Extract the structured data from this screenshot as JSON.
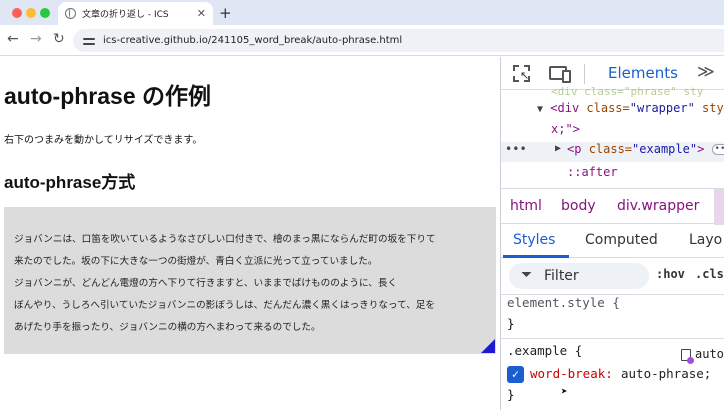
{
  "browser": {
    "tab_title": "文章の折り返し - ICS",
    "url": "ics-creative.github.io/241105_word_break/auto-phrase.html"
  },
  "page": {
    "title": "auto-phrase の作例",
    "lead": "右下のつまみを動かしてリサイズできます。",
    "section_heading": "auto-phrase方式",
    "example_lines": [
      "ジョバンニは、口笛を吹いているようなさびしい口付きで、檜のまっ黒にならんだ町の坂を下りて",
      "来たのでした。坂の下に大きな一つの街燈が、青白く立派に光って立っていました。",
      "ジョバンニが、どんどん電燈の方へ下りて行きますと、いままでばけもののように、長く",
      "ぼんやり、うしろへ引いていたジョバンニの影ぼうしは、だんだん濃く黒くはっきりなって、足を",
      "あげたり手を振ったり、ジョバンニの横の方へまわって来るのでした。"
    ]
  },
  "devtools": {
    "panel": "Elements",
    "dom": {
      "cut_line": "<div class=\"phrase\" sty",
      "wrapper_tag": "<div",
      "wrapper_attr": "class=",
      "wrapper_val": "\"wrapper\"",
      "wrapper_tail": "sty",
      "wrapper_line2": "x;\">",
      "p_tag_open": "<p",
      "p_attr": "class=",
      "p_val": "\"example\"",
      "p_tag_close": ">",
      "after": "::after"
    },
    "breadcrumbs": [
      "html",
      "body",
      "div.wrapper"
    ],
    "tabs": [
      "Styles",
      "Computed",
      "Layo"
    ],
    "filter_placeholder": "Filter",
    "hov": ":hov",
    "cls": ".cls",
    "element_style": "element.style {",
    "close_brace": "}",
    "example_selector": ".example {",
    "example_source": "auto",
    "property_name": "word-break",
    "property_value": "auto-phrase;"
  },
  "colors": {
    "accent": "#1a5fd0",
    "resize_handle": "#1b1bd6",
    "example_bg": "#dcdcdc"
  }
}
